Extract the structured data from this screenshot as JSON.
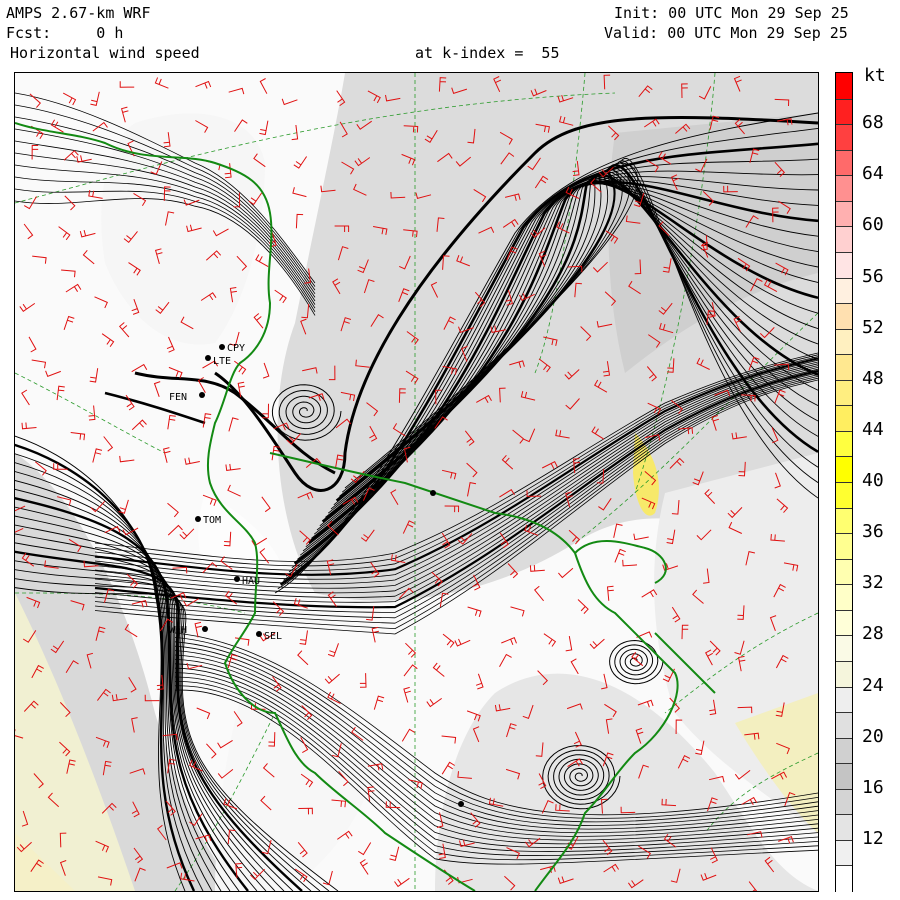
{
  "header": {
    "model": "AMPS 2.67-km WRF",
    "forecast": "Fcst:     0 h",
    "field": "Horizontal wind speed",
    "level": "at k-index =  55",
    "init": "Init: 00 UTC Mon 29 Sep 25",
    "valid": "Valid: 00 UTC Mon 29 Sep 25"
  },
  "colorbar": {
    "unit": "kt",
    "tick_labels": [
      "68",
      "64",
      "60",
      "56",
      "52",
      "48",
      "44",
      "40",
      "36",
      "32",
      "28",
      "24",
      "20",
      "16",
      "12"
    ],
    "segments": [
      {
        "color": "#ff0000"
      },
      {
        "color": "#ff2020"
      },
      {
        "color": "#ff4040"
      },
      {
        "color": "#ff6a6a"
      },
      {
        "color": "#ff9090"
      },
      {
        "color": "#ffb0b0"
      },
      {
        "color": "#ffd0d0"
      },
      {
        "color": "#ffe4e4"
      },
      {
        "color": "#fff0e0"
      },
      {
        "color": "#ffe0b0"
      },
      {
        "color": "#fff0c0"
      },
      {
        "color": "#ffe890"
      },
      {
        "color": "#ffee80"
      },
      {
        "color": "#ffee60"
      },
      {
        "color": "#ffff40"
      },
      {
        "color": "#ffff00"
      },
      {
        "color": "#ffff30"
      },
      {
        "color": "#ffff70"
      },
      {
        "color": "#ffff90"
      },
      {
        "color": "#ffffb0"
      },
      {
        "color": "#ffffc8"
      },
      {
        "color": "#ffffd8"
      },
      {
        "color": "#fafae6"
      },
      {
        "color": "#f5f5dc"
      },
      {
        "color": "#eeeeee"
      },
      {
        "color": "#e0e0e0"
      },
      {
        "color": "#d0d0d0"
      },
      {
        "color": "#c4c4c4"
      },
      {
        "color": "#d4d4d4"
      },
      {
        "color": "#e4e4e4"
      },
      {
        "color": "#f0f0f0"
      },
      {
        "color": "#ffffff"
      }
    ]
  },
  "stations": [
    {
      "id": "CPY"
    },
    {
      "id": "LTE"
    },
    {
      "id": "FEN"
    },
    {
      "id": "TOM"
    },
    {
      "id": "HAU"
    },
    {
      "id": "WHH"
    },
    {
      "id": "SEL"
    }
  ],
  "map_colors": {
    "coastline": "#138a13",
    "barbs": "#e01010",
    "gridlines": "#2a9a2a",
    "streamlines": "#000000"
  }
}
